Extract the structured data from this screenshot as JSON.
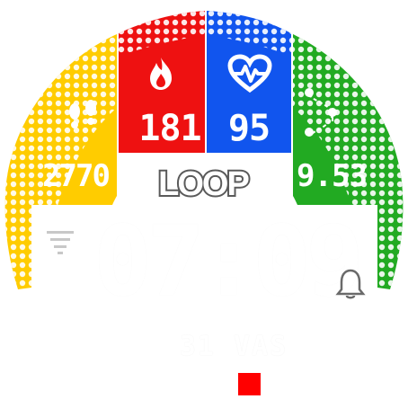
{
  "watchface": {
    "brand": "LOOP",
    "time": "07:09",
    "date": "31 VAS",
    "colors": {
      "steps_tile": "#ffcc00",
      "calories_tile": "#ee1111",
      "heart_tile": "#1155ee",
      "distance_tile": "#22aa22",
      "indicator": "#ff0000"
    },
    "tiles": {
      "steps": {
        "icon": "footprints-icon",
        "value": "2770"
      },
      "calories": {
        "icon": "flame-icon",
        "value": "181"
      },
      "heart_rate": {
        "icon": "heart-pulse-icon",
        "value": "95"
      },
      "distance": {
        "icon": "route-pins-icon",
        "value": "9.53"
      }
    },
    "status_icons": [
      "filter-icon",
      "bell-icon"
    ]
  }
}
